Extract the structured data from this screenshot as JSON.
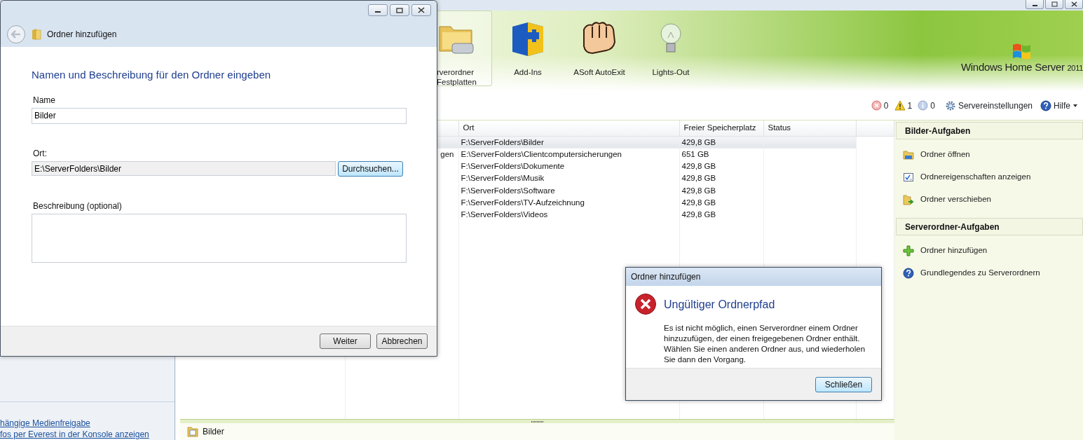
{
  "main_window": {
    "controls": [
      {
        "kind": "minimize"
      },
      {
        "kind": "maximize"
      },
      {
        "kind": "close"
      }
    ]
  },
  "toolbar": {
    "tabs": [
      {
        "lines": [
          "rverordner",
          "Festplatten"
        ],
        "kind": "folder",
        "selected": true
      },
      {
        "lines": [
          "Add-Ins"
        ],
        "kind": "puzzle",
        "selected": false
      },
      {
        "lines": [
          "ASoft AutoExit"
        ],
        "kind": "hand",
        "selected": false
      },
      {
        "lines": [
          "Lights-Out"
        ],
        "kind": "bulb",
        "selected": false
      }
    ],
    "logo": {
      "brand": "Windows Home Server",
      "version": "2011"
    }
  },
  "status": {
    "errors": "0",
    "warnings": "1",
    "infos": "0",
    "settings": "Servereinstellungen",
    "help": "Hilfe"
  },
  "table": {
    "columns": [
      null,
      null,
      "Ort",
      "Freier Speicherplatz",
      "Status"
    ],
    "rows": [
      {
        "ort": "F:\\ServerFolders\\Bilder",
        "free": "429,8 GB",
        "selected": true
      },
      {
        "column_2": "gen",
        "ort": "E:\\ServerFolders\\Clientcomputersicherungen",
        "free": "651 GB",
        "selected": false
      },
      {
        "ort": "F:\\ServerFolders\\Dokumente",
        "free": "429,8 GB",
        "selected": false
      },
      {
        "ort": "F:\\ServerFolders\\Musik",
        "free": "429,8 GB",
        "selected": false
      },
      {
        "ort": "F:\\ServerFolders\\Software",
        "free": "429,8 GB",
        "selected": false
      },
      {
        "ort": "F:\\ServerFolders\\TV-Aufzeichnung",
        "free": "429,8 GB",
        "selected": false
      },
      {
        "ort": "F:\\ServerFolders\\Videos",
        "free": "429,8 GB",
        "selected": false
      }
    ]
  },
  "tasks": [
    {
      "title": "Bilder-Aufgaben",
      "items": [
        {
          "label": "Ordner öffnen",
          "kind": "open"
        },
        {
          "label": "Ordnereigenschaften anzeigen",
          "kind": "properties"
        },
        {
          "label": "Ordner verschieben",
          "kind": "move"
        }
      ]
    },
    {
      "title": "Serverordner-Aufgaben",
      "items": [
        {
          "label": "Ordner hinzufügen",
          "kind": "add"
        },
        {
          "label": "Grundlegendes zu Serverordnern",
          "kind": "help"
        }
      ]
    }
  ],
  "left_links": [
    "hängige Medienfreigabe",
    "fos per Everest in der Konsole anzeigen"
  ],
  "details_bar": {
    "label": "Bilder"
  },
  "wizard": {
    "title": "Ordner hinzufügen",
    "heading": "Namen und Beschreibung für den Ordner eingeben",
    "fields": [
      {
        "kind": "text",
        "label": "Name",
        "value": "Bilder"
      },
      {
        "kind": "readonly",
        "label": "Ort:",
        "value": "E:\\ServerFolders\\Bilder",
        "button": "Durchsuchen..."
      },
      {
        "kind": "textarea",
        "label": "Beschreibung (optional)"
      }
    ],
    "buttons": [
      "Weiter",
      "Abbrechen"
    ]
  },
  "error_dialog": {
    "title": "Ordner hinzufügen",
    "heading": "Ungültiger Ordnerpfad",
    "message": "Es ist nicht möglich, einen Serverordner einem Ordner hinzuzufügen, der einen freigegebenen Ordner enthält. Wählen Sie einen anderen Ordner aus, und wiederholen Sie dann den Vorgang.",
    "button": "Schließen"
  }
}
